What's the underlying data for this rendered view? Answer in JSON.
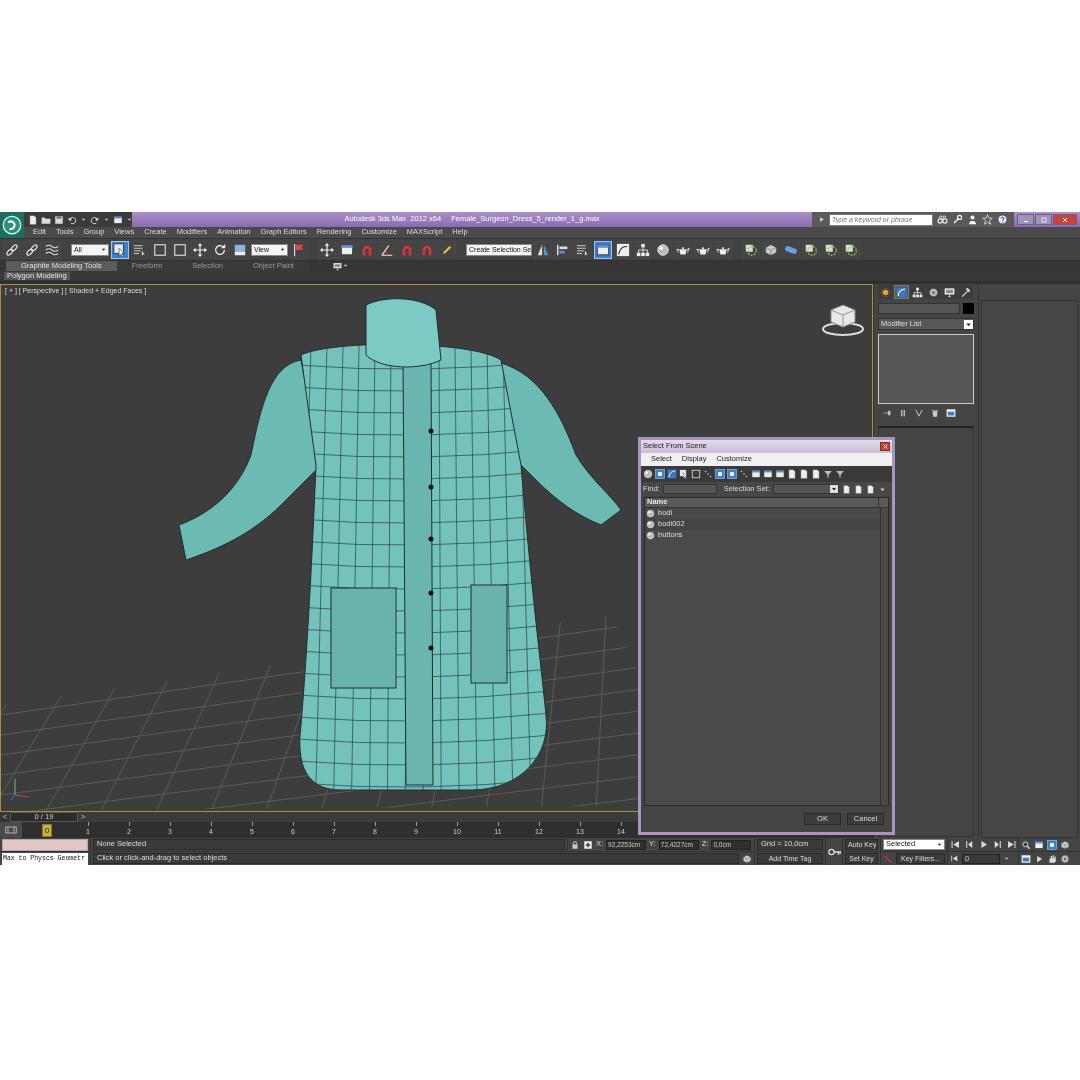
{
  "title_bar": {
    "app_title": "Autodesk 3ds Max  2012 x64",
    "file_name": "Female_Surgeon_Dress_5_render_1_g.max",
    "search": {
      "placeholder": "Type a keyword or phrase"
    }
  },
  "menu": [
    "Edit",
    "Tools",
    "Group",
    "Views",
    "Create",
    "Modifiers",
    "Animation",
    "Graph Editors",
    "Rendering",
    "Customize",
    "MAXScript",
    "Help"
  ],
  "main_toolbar": [
    {
      "kind": "button",
      "selected": false
    },
    {
      "kind": "button",
      "selected": false
    },
    {
      "kind": "button",
      "selected": false
    },
    {
      "kind": "dropdown",
      "value": "All"
    },
    {
      "kind": "button",
      "selected": true
    },
    {
      "kind": "button",
      "selected": false
    },
    {
      "kind": "button",
      "selected": false
    },
    {
      "kind": "button",
      "selected": false
    },
    {
      "kind": "button",
      "selected": false
    },
    {
      "kind": "button",
      "selected": false
    },
    {
      "kind": "button",
      "selected": false
    },
    {
      "kind": "dropdown",
      "value": "View"
    },
    {
      "kind": "button",
      "selected": false
    },
    {
      "kind": "button",
      "selected": false
    },
    {
      "kind": "button",
      "selected": false
    },
    {
      "kind": "button",
      "selected": false
    },
    {
      "kind": "button",
      "selected": false
    },
    {
      "kind": "button",
      "selected": false
    },
    {
      "kind": "button",
      "selected": false
    },
    {
      "kind": "button",
      "selected": false
    },
    {
      "kind": "dropdown",
      "value": "Create Selection Se"
    },
    {
      "kind": "button",
      "selected": false
    },
    {
      "kind": "button",
      "selected": false
    },
    {
      "kind": "button",
      "selected": false
    },
    {
      "kind": "button",
      "selected": true
    },
    {
      "kind": "button",
      "selected": false
    },
    {
      "kind": "button",
      "selected": false
    },
    {
      "kind": "button",
      "selected": false
    },
    {
      "kind": "button",
      "selected": false
    },
    {
      "kind": "button",
      "selected": false
    },
    {
      "kind": "button",
      "selected": false
    },
    {
      "kind": "button",
      "selected": false
    },
    {
      "kind": "button",
      "selected": false
    },
    {
      "kind": "button",
      "selected": false
    },
    {
      "kind": "button",
      "selected": false
    },
    {
      "kind": "button",
      "selected": false
    },
    {
      "kind": "button",
      "selected": false
    }
  ],
  "ribbon": {
    "tabs": [
      {
        "label": "Graphite Modeling Tools",
        "selected": true
      },
      {
        "label": "Freeform",
        "selected": false
      },
      {
        "label": "Selection",
        "selected": false
      },
      {
        "label": "Object Paint",
        "selected": false
      }
    ],
    "panel": "Polygon Modeling"
  },
  "viewport": {
    "label": "[ + ] [ Perspective ] [ Shaded + Edged Faces ]"
  },
  "command_panel": {
    "tabs": [
      {
        "selected": false
      },
      {
        "selected": true
      },
      {
        "selected": false
      },
      {
        "selected": false
      },
      {
        "selected": false
      },
      {
        "selected": false
      }
    ],
    "modifier_list": "Modifier List"
  },
  "dialog": {
    "title": "Select From Scene",
    "menu": [
      "Select",
      "Display",
      "Customize"
    ],
    "find_label": "Find:",
    "selection_set_label": "Selection Set:",
    "column": "Name",
    "rows": [
      {
        "name": "bodi",
        "selected": false
      },
      {
        "name": "bodi002",
        "selected": false
      },
      {
        "name": "buttons",
        "selected": false
      }
    ],
    "buttons": [
      "OK",
      "Cancel"
    ]
  },
  "time_slider": {
    "previous": "<",
    "frame": "0 / 19",
    "next": ">",
    "level": 0
  },
  "track_bar": {
    "current": "0",
    "ticks": [
      "1",
      "2",
      "3",
      "4",
      "5",
      "6",
      "7",
      "8",
      "9",
      "10",
      "11",
      "12",
      "13",
      "14"
    ]
  },
  "status_bar": {
    "script_output": "Max to Physcs Geometr",
    "selection": "None Selected",
    "prompt": "Click or click-and-drag to select objects",
    "x_label": "X:",
    "x": "92,2253cm",
    "y_label": "Y:",
    "y": "72,4227cm",
    "z_label": "Z:",
    "z": "0,0cm",
    "grid": "Grid = 10,0cm",
    "time_tag": "Add Time Tag",
    "auto_key": "Auto Key",
    "set_key": "Set Key",
    "key_mode": "Selected",
    "key_filters": "Key Filters...",
    "frame": "0"
  }
}
